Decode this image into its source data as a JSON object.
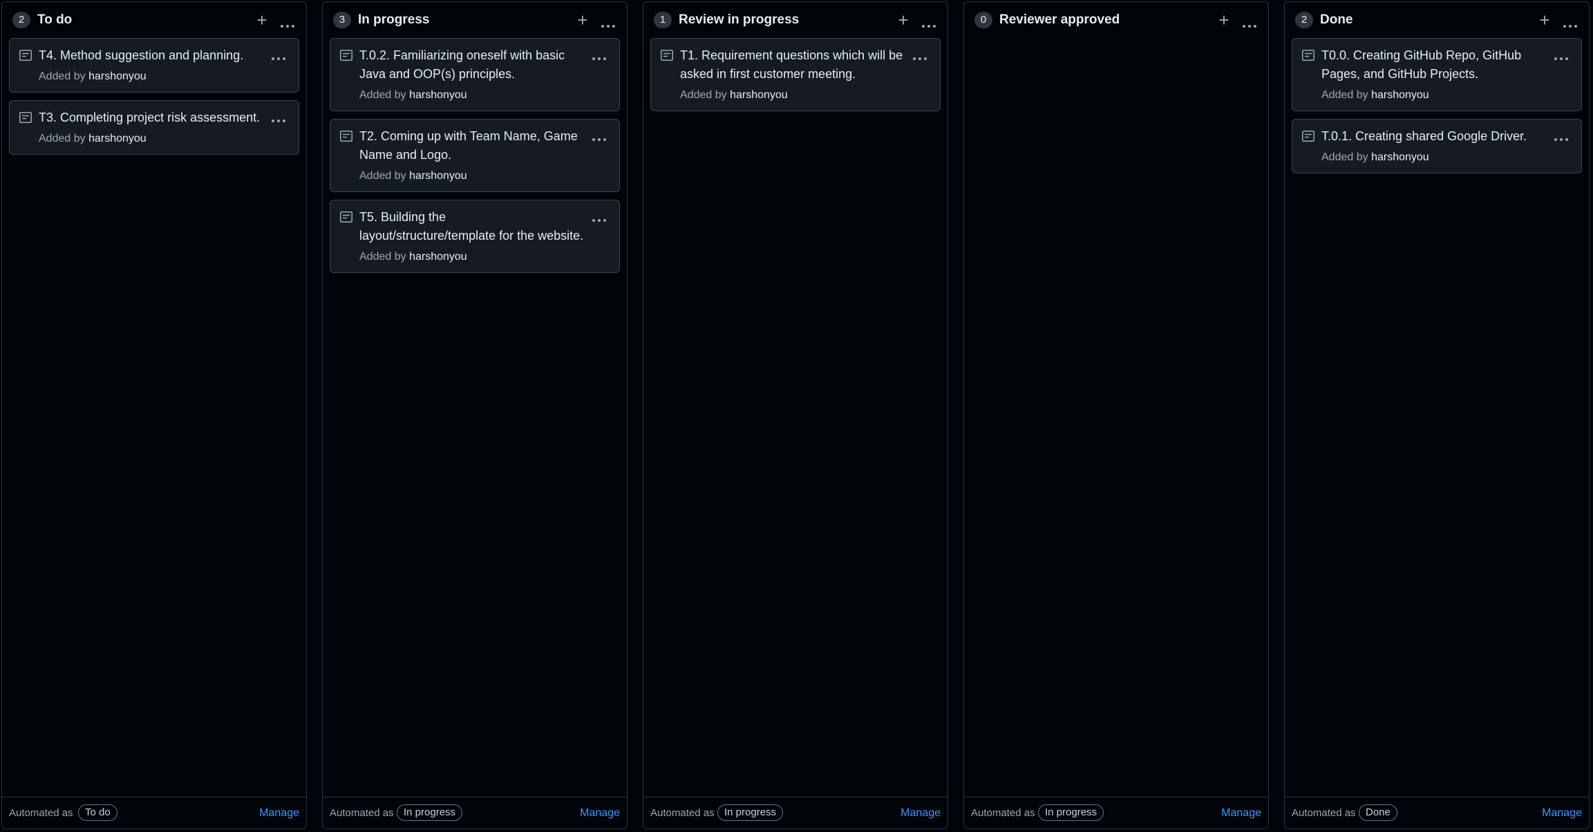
{
  "columns": [
    {
      "count": "2",
      "title": "To do",
      "cards": [
        {
          "title": "T4. Method suggestion and planning.",
          "added_by_prefix": "Added by",
          "author": "harshonyou"
        },
        {
          "title": "T3. Completing project risk assessment.",
          "added_by_prefix": "Added by",
          "author": "harshonyou"
        }
      ],
      "automated_label": "Automated as",
      "automated_state": "To do",
      "manage_label": "Manage"
    },
    {
      "count": "3",
      "title": "In progress",
      "cards": [
        {
          "title": "T.0.2. Familiarizing oneself with basic Java and OOP(s) principles.",
          "added_by_prefix": "Added by",
          "author": "harshonyou"
        },
        {
          "title": "T2. Coming up with Team Name, Game Name and Logo.",
          "added_by_prefix": "Added by",
          "author": "harshonyou"
        },
        {
          "title": "T5. Building the layout/structure/template for the website.",
          "added_by_prefix": "Added by",
          "author": "harshonyou"
        }
      ],
      "automated_label": "Automated as",
      "automated_state": "In progress",
      "manage_label": "Manage"
    },
    {
      "count": "1",
      "title": "Review in progress",
      "cards": [
        {
          "title": "T1. Requirement questions which will be asked in first customer meeting.",
          "added_by_prefix": "Added by",
          "author": "harshonyou"
        }
      ],
      "automated_label": "Automated as",
      "automated_state": "In progress",
      "manage_label": "Manage"
    },
    {
      "count": "0",
      "title": "Reviewer approved",
      "cards": [],
      "automated_label": "Automated as",
      "automated_state": "In progress",
      "manage_label": "Manage"
    },
    {
      "count": "2",
      "title": "Done",
      "cards": [
        {
          "title": "T0.0. Creating GitHub Repo, GitHub Pages, and GitHub Projects.",
          "added_by_prefix": "Added by",
          "author": "harshonyou"
        },
        {
          "title": "T.0.1. Creating shared Google Driver.",
          "added_by_prefix": "Added by",
          "author": "harshonyou"
        }
      ],
      "automated_label": "Automated as",
      "automated_state": "Done",
      "manage_label": "Manage"
    }
  ],
  "icons": {
    "add": "plus-icon",
    "more": "kebab-horizontal-icon",
    "card": "note-icon"
  },
  "colors": {
    "background": "#010409",
    "card": "#161b22",
    "border": "#30363d",
    "link": "#4493f8"
  }
}
